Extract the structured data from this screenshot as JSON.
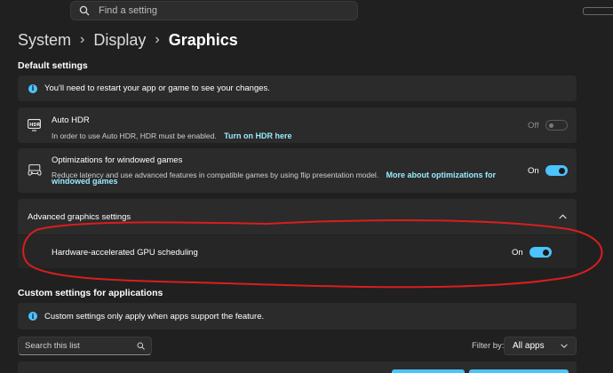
{
  "search": {
    "placeholder": "Find a setting"
  },
  "breadcrumb": {
    "items": [
      "System",
      "Display",
      "Graphics"
    ]
  },
  "default_settings": {
    "title": "Default settings",
    "restart_notice": "You'll need to restart your app or game to see your changes.",
    "auto_hdr": {
      "title": "Auto HDR",
      "description": "In order to use Auto HDR, HDR must be enabled.",
      "link": "Turn on HDR here",
      "state_label": "Off",
      "enabled": false
    },
    "windowed_games": {
      "title": "Optimizations for windowed games",
      "description": "Reduce latency and use advanced features in compatible games by using flip presentation model.",
      "link_part1": "More about optimizations for",
      "link_part2": "windowed games",
      "state_label": "On",
      "enabled": true
    }
  },
  "advanced": {
    "title": "Advanced graphics settings",
    "gpu_scheduling": {
      "title": "Hardware-accelerated GPU scheduling",
      "state_label": "On",
      "enabled": true
    }
  },
  "custom": {
    "title": "Custom settings for applications",
    "notice": "Custom settings only apply when apps support the feature.",
    "search_placeholder": "Search this list",
    "filter_label": "Filter by:",
    "filter_value": "All apps"
  },
  "colors": {
    "accent": "#4cc2ff",
    "link": "#99ebff",
    "annotation": "#d81e1e"
  }
}
